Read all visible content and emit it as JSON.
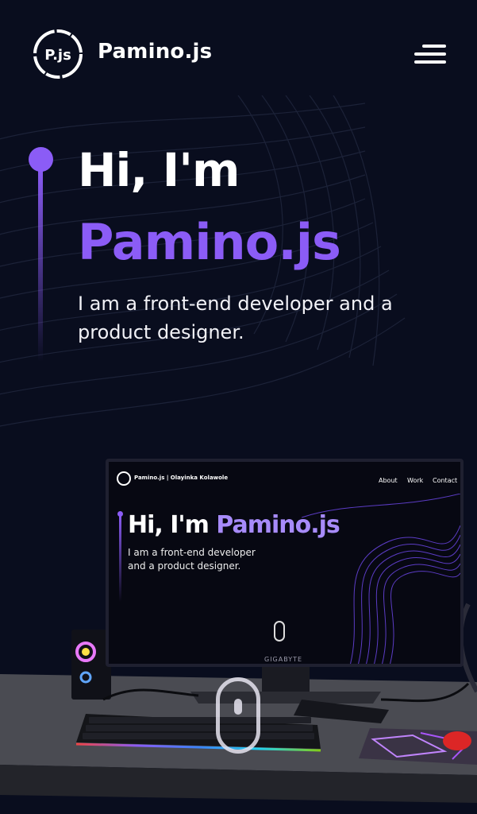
{
  "header": {
    "logo_text": "P.js",
    "brand": "Pamino.js",
    "menu_icon": "hamburger-menu-icon"
  },
  "hero": {
    "greeting": "Hi, I'm",
    "name": "Pamino.js",
    "description": "I am a front-end developer and a product designer."
  },
  "monitor_screen": {
    "brand": "Pamino.js | Olayinka Kolawole",
    "nav": [
      "About",
      "Work",
      "Contact"
    ],
    "greeting": "Hi, I'm",
    "name": "Pamino.js",
    "description": "I am a front-end developer and a product designer.",
    "monitor_brand": "GIGABYTE"
  },
  "scroll_indicator_icon": "mouse-scroll-icon",
  "colors": {
    "background": "#090d1e",
    "accent": "#8b5cf6",
    "text": "#ffffff"
  }
}
